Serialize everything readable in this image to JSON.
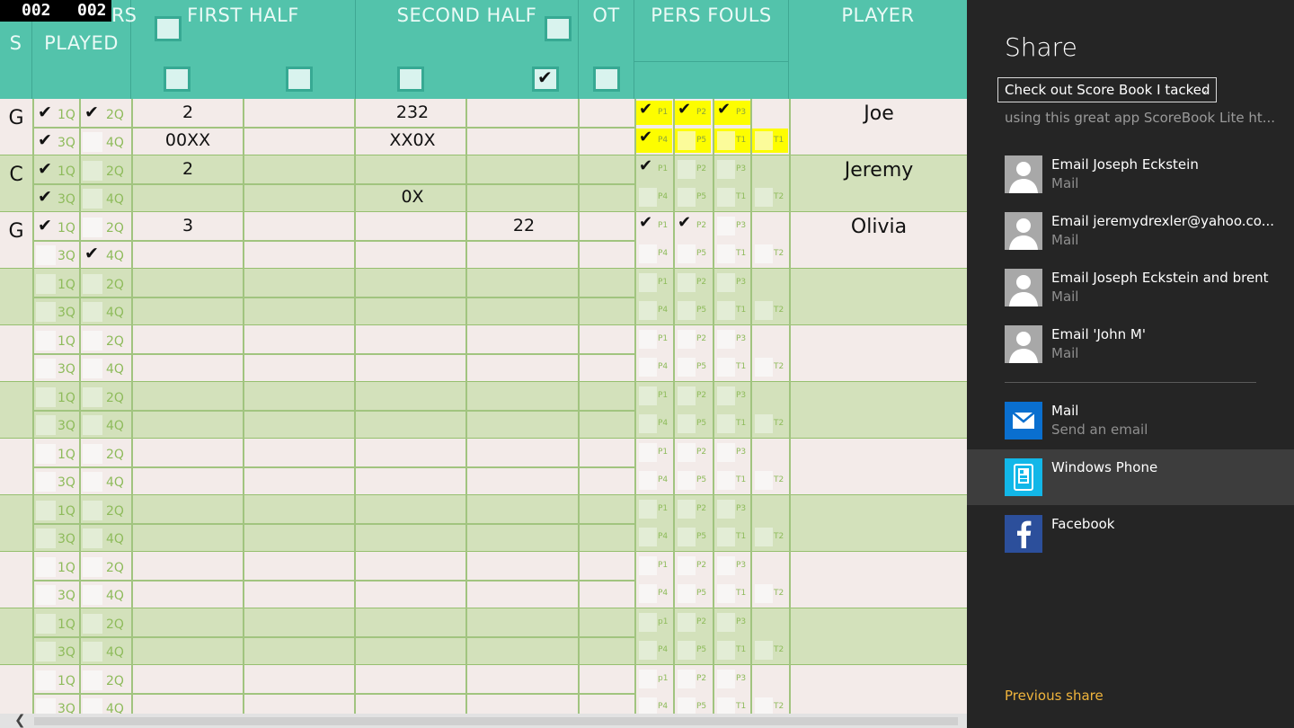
{
  "corner": {
    "left": "002",
    "right": "002",
    "behind": "RS"
  },
  "header": {
    "positions": "S",
    "played": "PLAYED",
    "first_half": "FIRST HALF",
    "second_half": "SECOND HALF",
    "ot": "OT",
    "pers_fouls": "PERS FOULS",
    "player": "PLAYER",
    "checks": {
      "first_half_top": false,
      "first_half_left": false,
      "first_half_right": false,
      "second_half_top": false,
      "second_half_left": false,
      "second_half_right": true,
      "ot": false
    }
  },
  "quarter_labels": [
    "1Q",
    "2Q",
    "3Q",
    "4Q"
  ],
  "foul_labels": [
    "P1",
    "P2",
    "P3",
    "P4",
    "P5",
    "T1",
    "T2"
  ],
  "rows": [
    {
      "position": "G",
      "player": "Joe",
      "quarters": [
        true,
        true,
        true,
        false
      ],
      "first_half": [
        "2",
        "00XX"
      ],
      "second_half": [
        "232",
        "XX0X"
      ],
      "second_half_b": [
        "",
        ""
      ],
      "fouls": [
        true,
        true,
        true,
        true,
        false,
        false,
        false
      ],
      "foul_highlight": true,
      "foul_labels": [
        "P1",
        "P2",
        "P3",
        "P4",
        "P5",
        "T1",
        "T1"
      ]
    },
    {
      "position": "C",
      "player": "Jeremy",
      "quarters": [
        true,
        false,
        true,
        false
      ],
      "first_half": [
        "2",
        ""
      ],
      "second_half": [
        "",
        "0X"
      ],
      "second_half_b": [
        "",
        ""
      ],
      "fouls": [
        true,
        false,
        false,
        false,
        false,
        false,
        false
      ],
      "foul_highlight": false,
      "foul_labels": [
        "P1",
        "P2",
        "P3",
        "P4",
        "P5",
        "T1",
        "T2"
      ]
    },
    {
      "position": "G",
      "player": "Olivia",
      "quarters": [
        true,
        false,
        false,
        true
      ],
      "first_half": [
        "3",
        ""
      ],
      "second_half": [
        "",
        ""
      ],
      "second_half_b": [
        "22",
        ""
      ],
      "fouls": [
        true,
        true,
        false,
        false,
        false,
        false,
        false
      ],
      "foul_highlight": false,
      "foul_labels": [
        "P1",
        "P2",
        "P3",
        "P4",
        "P5",
        "T1",
        "T2"
      ]
    },
    {
      "position": "",
      "player": "",
      "quarters": [
        false,
        false,
        false,
        false
      ],
      "first_half": [
        "",
        ""
      ],
      "second_half": [
        "",
        ""
      ],
      "second_half_b": [
        "",
        ""
      ],
      "fouls": [
        false,
        false,
        false,
        false,
        false,
        false,
        false
      ],
      "foul_highlight": false,
      "foul_labels": [
        "P1",
        "P2",
        "P3",
        "P4",
        "P5",
        "T1",
        "T2"
      ]
    },
    {
      "position": "",
      "player": "",
      "quarters": [
        false,
        false,
        false,
        false
      ],
      "first_half": [
        "",
        ""
      ],
      "second_half": [
        "",
        ""
      ],
      "second_half_b": [
        "",
        ""
      ],
      "fouls": [
        false,
        false,
        false,
        false,
        false,
        false,
        false
      ],
      "foul_highlight": false,
      "foul_labels": [
        "P1",
        "P2",
        "P3",
        "P4",
        "P5",
        "T1",
        "T2"
      ]
    },
    {
      "position": "",
      "player": "",
      "quarters": [
        false,
        false,
        false,
        false
      ],
      "first_half": [
        "",
        ""
      ],
      "second_half": [
        "",
        ""
      ],
      "second_half_b": [
        "",
        ""
      ],
      "fouls": [
        false,
        false,
        false,
        false,
        false,
        false,
        false
      ],
      "foul_highlight": false,
      "foul_labels": [
        "P1",
        "P2",
        "P3",
        "P4",
        "P5",
        "T1",
        "T2"
      ]
    },
    {
      "position": "",
      "player": "",
      "quarters": [
        false,
        false,
        false,
        false
      ],
      "first_half": [
        "",
        ""
      ],
      "second_half": [
        "",
        ""
      ],
      "second_half_b": [
        "",
        ""
      ],
      "fouls": [
        false,
        false,
        false,
        false,
        false,
        false,
        false
      ],
      "foul_highlight": false,
      "foul_labels": [
        "P1",
        "P2",
        "P3",
        "P4",
        "P5",
        "T1",
        "T2"
      ]
    },
    {
      "position": "",
      "player": "",
      "quarters": [
        false,
        false,
        false,
        false
      ],
      "first_half": [
        "",
        ""
      ],
      "second_half": [
        "",
        ""
      ],
      "second_half_b": [
        "",
        ""
      ],
      "fouls": [
        false,
        false,
        false,
        false,
        false,
        false,
        false
      ],
      "foul_highlight": false,
      "foul_labels": [
        "P1",
        "P2",
        "P3",
        "P4",
        "P5",
        "T1",
        "T2"
      ]
    },
    {
      "position": "",
      "player": "",
      "quarters": [
        false,
        false,
        false,
        false
      ],
      "first_half": [
        "",
        ""
      ],
      "second_half": [
        "",
        ""
      ],
      "second_half_b": [
        "",
        ""
      ],
      "fouls": [
        false,
        false,
        false,
        false,
        false,
        false,
        false
      ],
      "foul_highlight": false,
      "foul_labels": [
        "P1",
        "P2",
        "P3",
        "P4",
        "P5",
        "T1",
        "T2"
      ]
    },
    {
      "position": "",
      "player": "",
      "quarters": [
        false,
        false,
        false,
        false
      ],
      "first_half": [
        "",
        ""
      ],
      "second_half": [
        "",
        ""
      ],
      "second_half_b": [
        "",
        ""
      ],
      "fouls": [
        false,
        false,
        false,
        false,
        false,
        false,
        false
      ],
      "foul_highlight": false,
      "foul_labels": [
        "p1",
        "P2",
        "P3",
        "P4",
        "P5",
        "T1",
        "T2"
      ]
    },
    {
      "position": "",
      "player": "",
      "quarters": [
        false,
        false,
        false,
        false
      ],
      "first_half": [
        "",
        ""
      ],
      "second_half": [
        "",
        ""
      ],
      "second_half_b": [
        "",
        ""
      ],
      "fouls": [
        false,
        false,
        false,
        false,
        false,
        false,
        false
      ],
      "foul_highlight": false,
      "foul_labels": [
        "p1",
        "P2",
        "P3",
        "P4",
        "P5",
        "T1",
        "T2"
      ]
    }
  ],
  "share": {
    "title": "Share",
    "subject": "Check out Score Book I tacked",
    "body": "using this great app ScoreBook Lite ht...",
    "targets": [
      {
        "name": "Email Joseph Eckstein",
        "sub": "Mail",
        "icon": "contact-avatar-icon"
      },
      {
        "name": "Email jeremydrexler@yahoo.co...",
        "sub": "Mail",
        "icon": "contact-avatar-icon"
      },
      {
        "name": "Email Joseph Eckstein and brent",
        "sub": "Mail",
        "icon": "contact-avatar-icon"
      },
      {
        "name": "Email 'John M'",
        "sub": "Mail",
        "icon": "contact-avatar-icon"
      }
    ],
    "apps": [
      {
        "name": "Mail",
        "sub": "Send an email",
        "icon": "mail-app-icon",
        "color": "#0a6fcf"
      },
      {
        "name": "Windows Phone",
        "sub": "",
        "icon": "windows-phone-icon",
        "color": "#12b7e8",
        "selected": true
      },
      {
        "name": "Facebook",
        "sub": "",
        "icon": "facebook-icon",
        "color": "#2c4f9b"
      }
    ],
    "previous_share": "Previous share"
  },
  "colors": {
    "header": "#53c3ab",
    "row_light": "#f3ebe9",
    "row_green": "#d3e1bb",
    "foul_highlight": "#fdfd00",
    "share_bg": "#252525",
    "previous_share": "#f0b43c"
  }
}
